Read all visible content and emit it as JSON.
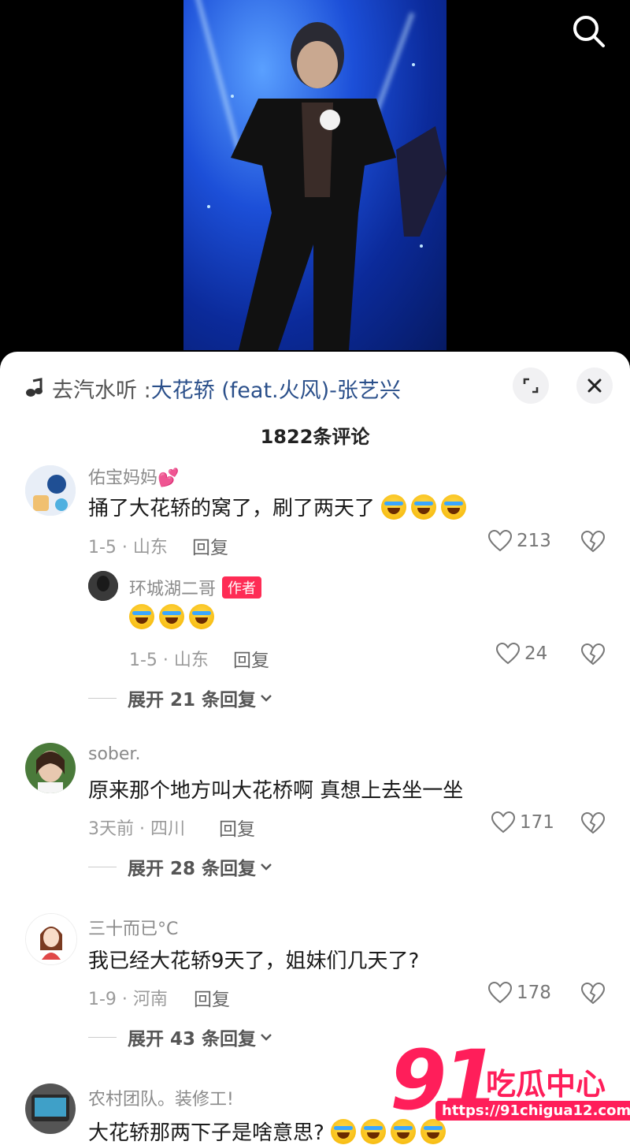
{
  "music": {
    "prefix": "去汽水听 : ",
    "song": "大花轿 (feat.火风)-张艺兴"
  },
  "comments_count": "1822条评论",
  "comments": [
    {
      "username": "佑宝妈妈💕",
      "text": "捅了大花轿的窝了，刷了两天了",
      "emoji_count": 3,
      "meta": "1-5 · 山东",
      "reply_label": "回复",
      "likes": "213",
      "sub_reply": {
        "username": "环城湖二哥",
        "badge": "作者",
        "emoji_count": 3,
        "meta": "1-5 · 山东",
        "reply_label": "回复",
        "likes": "24"
      },
      "expand_label": "展开 21 条回复"
    },
    {
      "username": "sober.",
      "text": "原来那个地方叫大花桥啊  真想上去坐一坐",
      "meta": "3天前 · 四川",
      "reply_label": "回复",
      "likes": "171",
      "expand_label": "展开 28 条回复"
    },
    {
      "username": "三十而已°C",
      "text": "我已经大花轿9天了，姐妹们几天了?",
      "meta": "1-9 · 河南",
      "reply_label": "回复",
      "likes": "178",
      "expand_label": "展开 43 条回复"
    },
    {
      "username": "农村团队。装修工!",
      "text": "大花轿那两下子是啥意思?"
    }
  ],
  "watermark": {
    "number": "91",
    "title": "吃瓜中心",
    "url": "https://91chigua12.com"
  },
  "colors": {
    "brand_red": "#fe2c55",
    "watermark_red": "#ff1e5a",
    "link_blue": "#2a4f8a"
  },
  "icons": [
    "search-icon",
    "music-note-icon",
    "expand-icon",
    "close-icon",
    "heart-icon",
    "broken-heart-icon",
    "chevron-down-icon"
  ]
}
